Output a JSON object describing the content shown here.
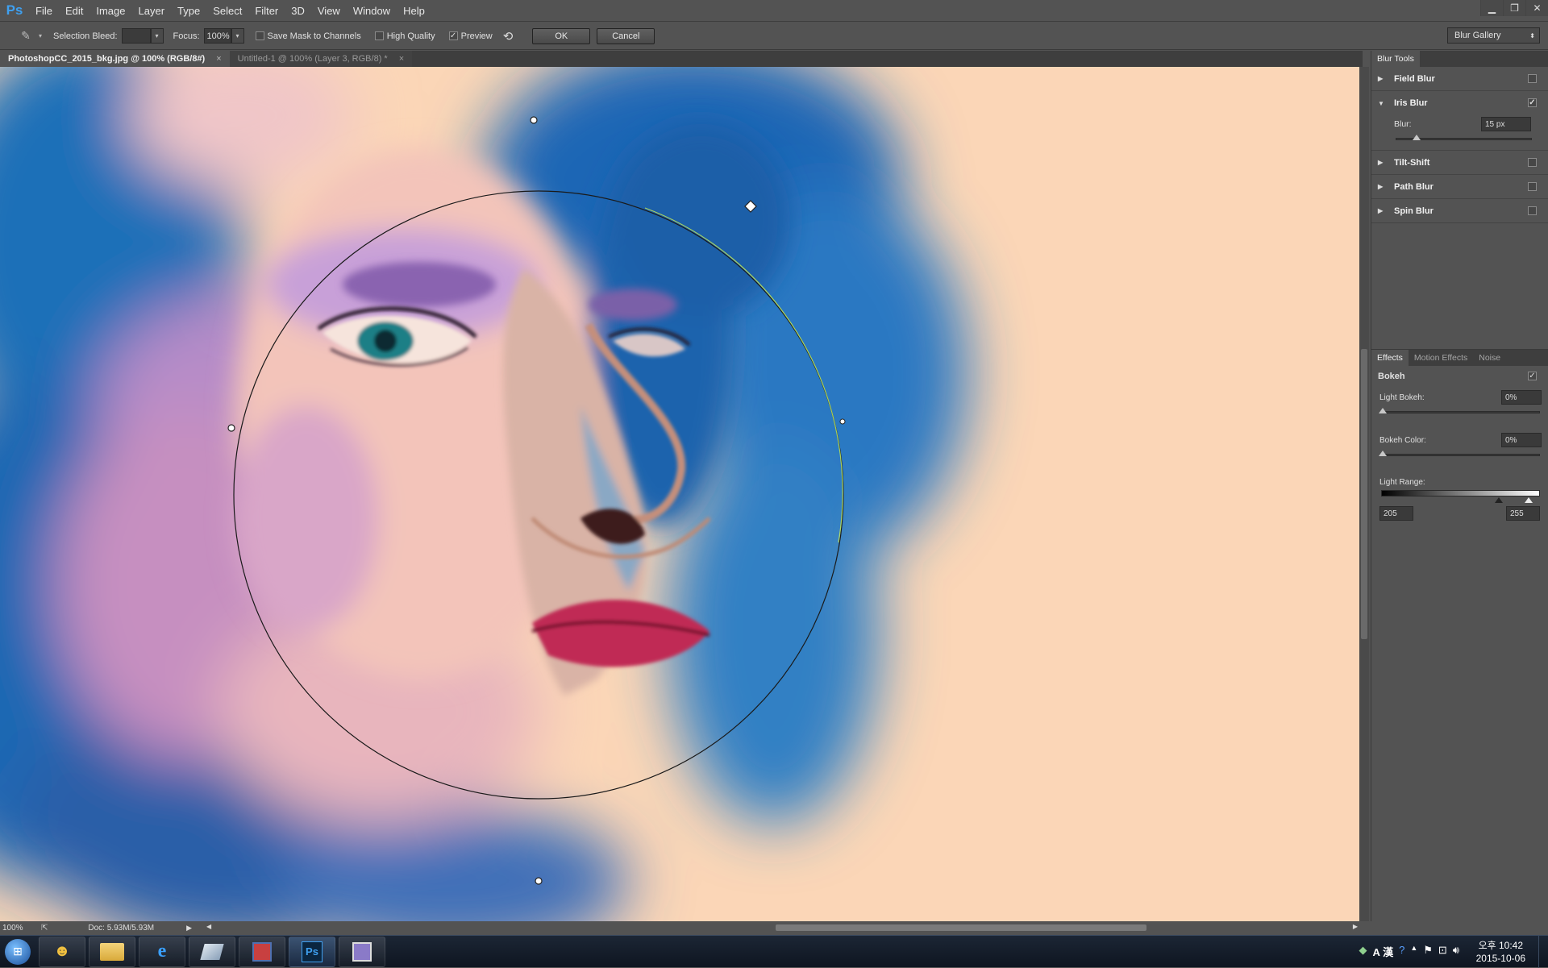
{
  "app": {
    "logo": "Ps"
  },
  "menu": [
    "File",
    "Edit",
    "Image",
    "Layer",
    "Type",
    "Select",
    "Filter",
    "3D",
    "View",
    "Window",
    "Help"
  ],
  "window_controls": [
    "minimize-icon",
    "restore-icon",
    "close-icon"
  ],
  "options": {
    "selection_bleed_label": "Selection Bleed:",
    "selection_bleed_value": "",
    "focus_label": "Focus:",
    "focus_value": "100%",
    "save_mask_label": "Save Mask to Channels",
    "save_mask_checked": false,
    "high_quality_label": "High Quality",
    "high_quality_checked": false,
    "preview_label": "Preview",
    "preview_checked": true,
    "ok_label": "OK",
    "cancel_label": "Cancel",
    "workspace": "Blur Gallery"
  },
  "tabs": [
    {
      "label": "PhotoshopCC_2015_bkg.jpg @ 100% (RGB/8#)",
      "active": true
    },
    {
      "label": "Untitled-1 @ 100% (Layer 3, RGB/8) *",
      "active": false
    }
  ],
  "status": {
    "zoom": "100%",
    "doc": "Doc: 5.93M/5.93M"
  },
  "blur_tools": {
    "title": "Blur Tools",
    "items": [
      {
        "label": "Field Blur",
        "checked": false,
        "expanded": false
      },
      {
        "label": "Iris Blur",
        "checked": true,
        "expanded": true
      },
      {
        "label": "Tilt-Shift",
        "checked": false,
        "expanded": false
      },
      {
        "label": "Path Blur",
        "checked": false,
        "expanded": false
      },
      {
        "label": "Spin Blur",
        "checked": false,
        "expanded": false
      }
    ],
    "iris_blur_label": "Blur:",
    "iris_blur_value": "15 px",
    "iris_blur_level": 0.15
  },
  "effects": {
    "tabs": [
      "Effects",
      "Motion Effects",
      "Noise"
    ],
    "bokeh_label": "Bokeh",
    "bokeh_checked": true,
    "light_bokeh_label": "Light Bokeh:",
    "light_bokeh_value": "0%",
    "bokeh_color_label": "Bokeh Color:",
    "bokeh_color_value": "0%",
    "light_range_label": "Light Range:",
    "light_range_min": "205",
    "light_range_max": "255"
  },
  "taskbar": {
    "apps": [
      "windows-start-icon",
      "users-icon",
      "folder-icon",
      "internet-explorer-icon",
      "app-icon",
      "save-app-icon",
      "photoshop-icon",
      "media-icon"
    ],
    "ps_label": "Ps",
    "tray_text": "A 漢",
    "time": "오후 10:42",
    "date": "2015-10-06"
  },
  "colors": {
    "chrome": "#535353",
    "dark": "#3e3e3e",
    "accent": "#3fa0f0",
    "canvas_bg": "#fbd6b7"
  }
}
